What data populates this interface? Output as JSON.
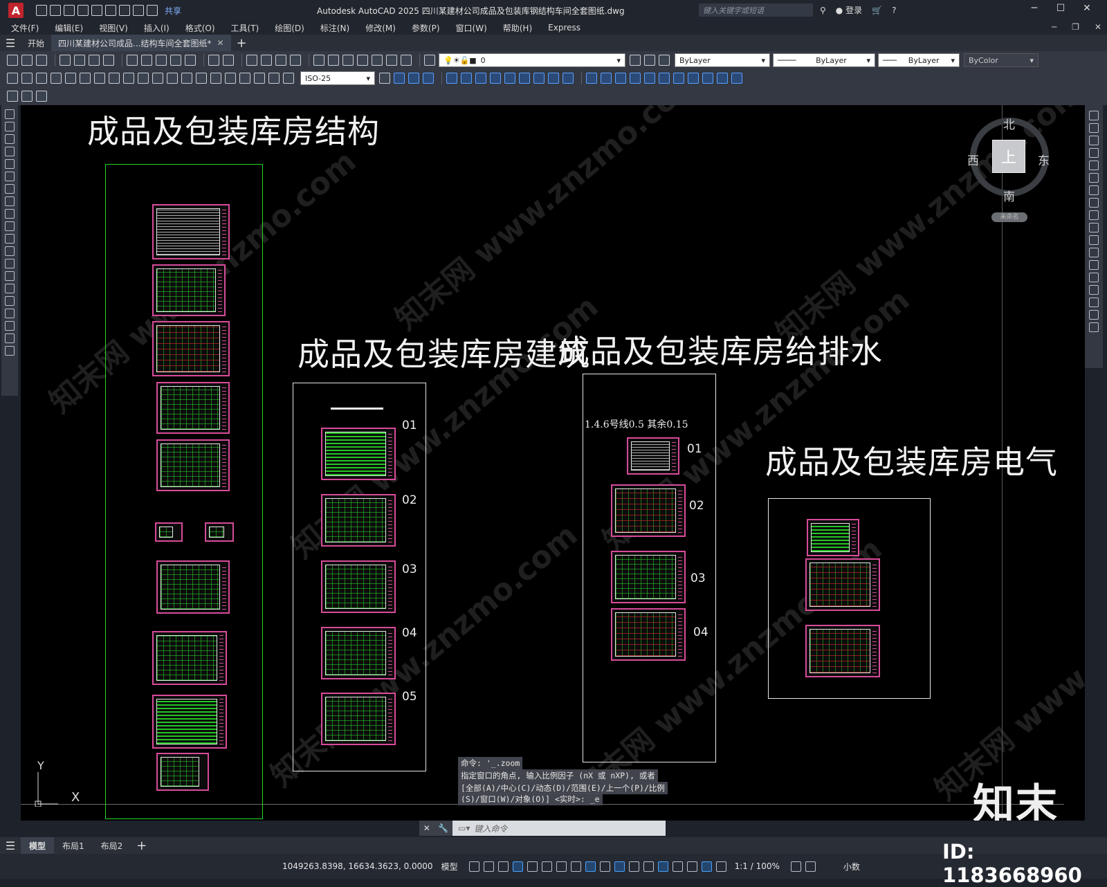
{
  "titlebar": {
    "app_icon": "A",
    "share_label": "共享",
    "title": "Autodesk AutoCAD 2025    四川某建材公司成品及包装库钢结构车间全套图纸.dwg",
    "search_placeholder": "键入关键字或短语",
    "login_label": "登录",
    "help_icon": "?"
  },
  "menubar": {
    "items": [
      "文件(F)",
      "编辑(E)",
      "视图(V)",
      "插入(I)",
      "格式(O)",
      "工具(T)",
      "绘图(D)",
      "标注(N)",
      "修改(M)",
      "参数(P)",
      "窗口(W)",
      "帮助(H)",
      "Express"
    ]
  },
  "tabs": {
    "start_label": "开始",
    "doc_label": "四川某建材公司成品...结构车间全套图纸*"
  },
  "toolbar": {
    "layer_value": "0",
    "color_value": "ByLayer",
    "linetype_value": "ByLayer",
    "lineweight_value": "ByLayer",
    "plotstyle_value": "ByColor",
    "dimstyle_value": "ISO-25"
  },
  "drawing": {
    "group_structure": {
      "title": "成品及包装库房结构"
    },
    "group_architecture": {
      "title": "成品及包装库房建筑",
      "labels": [
        "01",
        "02",
        "03",
        "04",
        "05"
      ]
    },
    "group_plumbing": {
      "title": "成品及包装库房给排水",
      "note": "1.4.6号线0.5  其余0.15",
      "labels": [
        "01",
        "02",
        "03",
        "04"
      ]
    },
    "group_electrical": {
      "title": "成品及包装库房电气"
    }
  },
  "viewcube": {
    "north": "北",
    "south": "南",
    "east": "东",
    "west": "西",
    "face": "上",
    "wcs_label": "未命名"
  },
  "ucs": {
    "x_label": "X",
    "y_label": "Y"
  },
  "command": {
    "history": [
      "命令: '_.zoom",
      "指定窗口的角点, 输入比例因子 (nX 或 nXP), 或者",
      "[全部(A)/中心(C)/动态(D)/范围(E)/上一个(P)/比例",
      "(S)/窗口(W)/对象(O)] <实时>: _e"
    ],
    "input_placeholder": "键入命令"
  },
  "layouts": {
    "tabs": [
      "模型",
      "布局1",
      "布局2"
    ],
    "active": "模型"
  },
  "statusbar": {
    "coordinates": "1049263.8398, 16634.3623, 0.0000",
    "mode": "模型",
    "scale": "1:1 / 100%",
    "units": "小数"
  },
  "watermark": {
    "brand": "知末",
    "id_text": "ID: 1183668960",
    "diag_text": "知末网 www.znzmo.com"
  }
}
